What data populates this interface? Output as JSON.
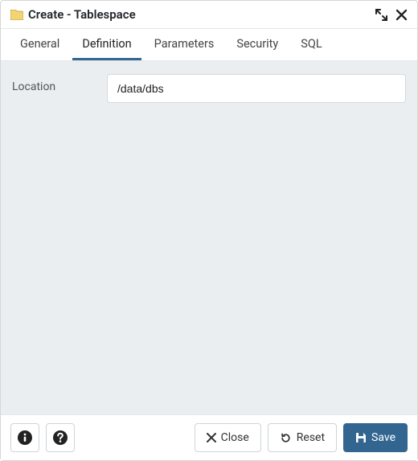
{
  "header": {
    "title": "Create - Tablespace",
    "icons": {
      "folder": "folder-icon",
      "expand": "expand-icon",
      "close": "close-icon"
    }
  },
  "tabs": [
    {
      "label": "General",
      "active": false
    },
    {
      "label": "Definition",
      "active": true
    },
    {
      "label": "Parameters",
      "active": false
    },
    {
      "label": "Security",
      "active": false
    },
    {
      "label": "SQL",
      "active": false
    }
  ],
  "form": {
    "location": {
      "label": "Location",
      "value": "/data/dbs"
    }
  },
  "footer": {
    "info_icon": "info-icon",
    "help_icon": "help-icon",
    "close_label": "Close",
    "reset_label": "Reset",
    "save_label": "Save"
  }
}
